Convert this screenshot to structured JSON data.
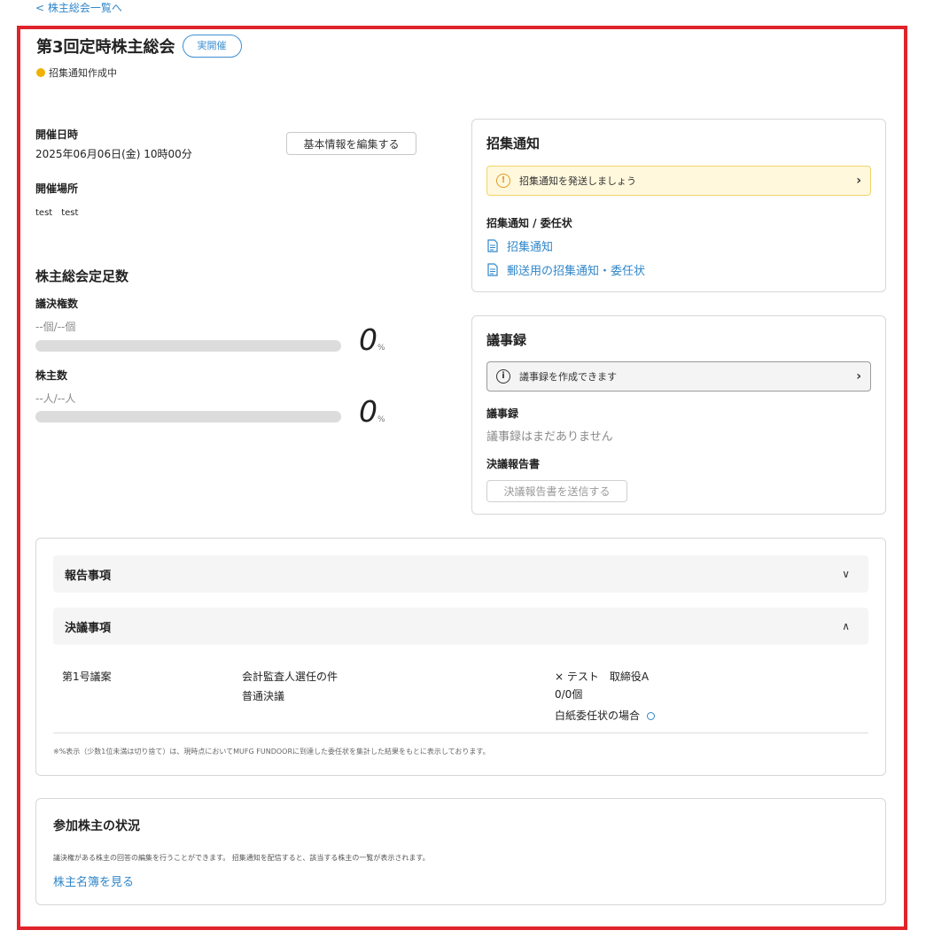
{
  "back_link": "< 株主総会一覧へ",
  "meeting": {
    "title": "第3回定時株主総会",
    "badge": "実開催",
    "status": "招集通知作成中",
    "status_color": "#f0b100"
  },
  "basic_info": {
    "datetime_label": "開催日時",
    "datetime_value": "2025年06月06日(金) 10時00分",
    "edit_button": "基本情報を編集する",
    "place_label": "開催場所",
    "place_value": "test　test"
  },
  "quorum": {
    "title": "株主総会定足数",
    "votes_label": "議決権数",
    "votes_value": "--個/--個",
    "votes_percent": "0",
    "votes_fill": 0,
    "holders_label": "株主数",
    "holders_value": "--人/--人",
    "holders_percent": "0",
    "holders_fill": 0,
    "percent_unit": "%"
  },
  "notice_card": {
    "title": "招集通知",
    "alert": "招集通知を発送しましょう",
    "docs_label": "招集通知 / 委任状",
    "doc_1": "招集通知",
    "doc_2": "郵送用の招集通知・委任状"
  },
  "minutes_card": {
    "title": "議事録",
    "alert": "議事録を作成できます",
    "minutes_label": "議事録",
    "minutes_empty": "議事録はまだありません",
    "report_label": "決議報告書",
    "report_button": "決議報告書を送信する"
  },
  "agenda": {
    "report_items": "報告事項",
    "resolution_items": "決議事項",
    "proposal": {
      "number": "第1号議案",
      "name": "会計監査人選任の件",
      "type": "普通決議",
      "vote_line": "× テスト　取締役A",
      "count": "0/0個",
      "blank_proxy": "白紙委任状の場合"
    },
    "footnote": "※%表示（少数1位未満は切り捨て）は、現時点においてMUFG FUNDOORに到達した委任状を集計した結果をもとに表示しております。"
  },
  "participants": {
    "title": "参加株主の状況",
    "description": "議決権がある株主の回答の編集を行うことができます。 招集通知を配信すると、該当する株主の一覧が表示されます。",
    "link": "株主名簿を見る"
  },
  "colors": {
    "accent": "#2f86c9",
    "highlight_frame": "#e0232a"
  }
}
